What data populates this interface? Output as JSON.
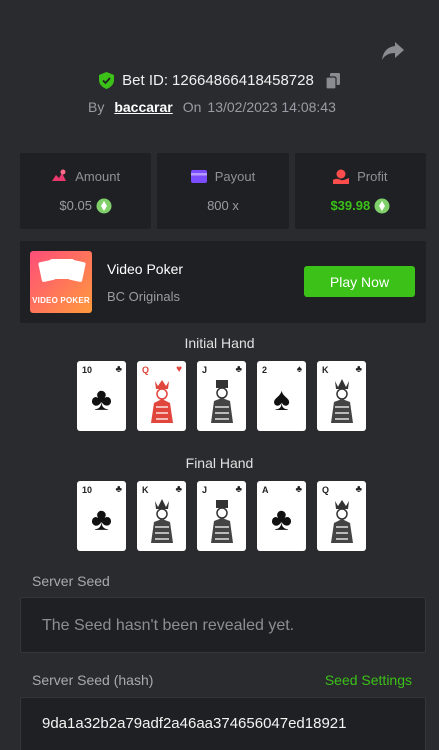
{
  "header": {
    "bet_id_label": "Bet ID:",
    "bet_id": "12664866418458728",
    "by_label": "By",
    "username": "baccarar",
    "on_label": "On",
    "datetime": "13/02/2023 14:08:43"
  },
  "stats": {
    "amount_label": "Amount",
    "amount_value": "$0.05",
    "payout_label": "Payout",
    "payout_value": "800 x",
    "profit_label": "Profit",
    "profit_value": "$39.98"
  },
  "game": {
    "thumb_text": "VIDEO POKER",
    "title": "Video Poker",
    "subtitle": "BC Originals",
    "play_label": "Play Now"
  },
  "initial_hand": {
    "label": "Initial Hand",
    "cards": [
      {
        "rank": "10",
        "suit": "clubs",
        "suit_symbol": "♣"
      },
      {
        "rank": "Q",
        "suit": "hearts",
        "suit_symbol": "♥"
      },
      {
        "rank": "J",
        "suit": "clubs",
        "suit_symbol": "♣"
      },
      {
        "rank": "2",
        "suit": "spades",
        "suit_symbol": "♠"
      },
      {
        "rank": "K",
        "suit": "clubs",
        "suit_symbol": "♣"
      }
    ]
  },
  "final_hand": {
    "label": "Final Hand",
    "cards": [
      {
        "rank": "10",
        "suit": "clubs",
        "suit_symbol": "♣"
      },
      {
        "rank": "K",
        "suit": "clubs",
        "suit_symbol": "♣"
      },
      {
        "rank": "J",
        "suit": "clubs",
        "suit_symbol": "♣"
      },
      {
        "rank": "A",
        "suit": "clubs",
        "suit_symbol": "♣"
      },
      {
        "rank": "Q",
        "suit": "clubs",
        "suit_symbol": "♣"
      }
    ]
  },
  "server_seed": {
    "label": "Server Seed",
    "value": "The Seed hasn't been revealed yet."
  },
  "server_seed_hash": {
    "label": "Server Seed (hash)",
    "settings_link": "Seed Settings",
    "value": "9da1a32b2a79adf2a46aa374656047ed18921"
  },
  "colors": {
    "accent_green": "#3bc117",
    "background": "#2a2b2f",
    "panel": "#1f2023",
    "heart_red": "#e0463b"
  },
  "icons": [
    "share-icon",
    "shield-check-icon",
    "copy-icon",
    "amount-icon",
    "payout-icon",
    "profit-icon",
    "coin-icon"
  ]
}
